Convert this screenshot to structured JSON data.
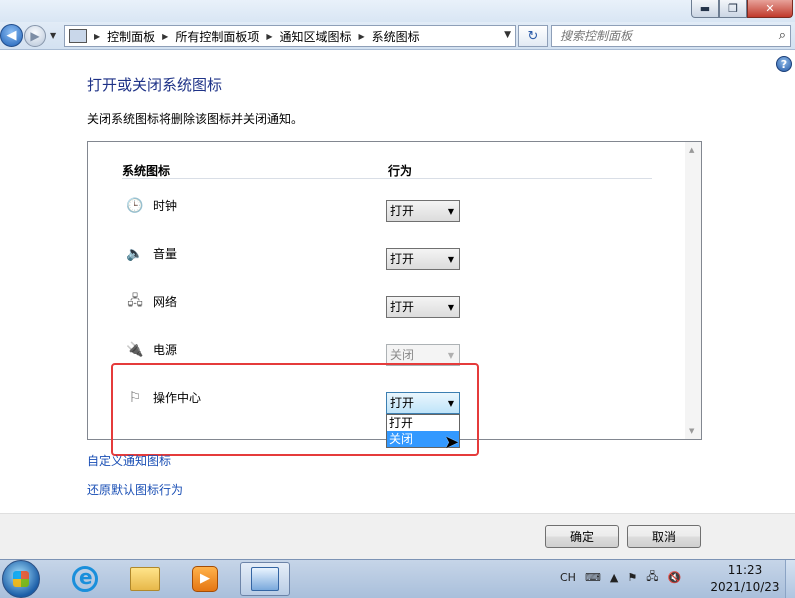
{
  "window": {
    "minimize_glyph": "▬",
    "maximize_glyph": "❐",
    "close_glyph": "✕"
  },
  "nav": {
    "back_glyph": "◀",
    "forward_glyph": "▶",
    "breadcrumb": [
      "控制面板",
      "所有控制面板项",
      "通知区域图标",
      "系统图标"
    ],
    "search_placeholder": "搜索控制面板",
    "refresh_glyph": "↻"
  },
  "help_label": "?",
  "page": {
    "title": "打开或关闭系统图标",
    "description": "关闭系统图标将删除该图标并关闭通知。"
  },
  "table": {
    "col_icon": "系统图标",
    "col_behavior": "行为",
    "rows": [
      {
        "icon": "clock-icon",
        "label": "时钟",
        "value": "打开",
        "disabled": false
      },
      {
        "icon": "volume-icon",
        "label": "音量",
        "value": "打开",
        "disabled": false
      },
      {
        "icon": "network-icon",
        "label": "网络",
        "value": "打开",
        "disabled": false
      },
      {
        "icon": "power-icon",
        "label": "电源",
        "value": "关闭",
        "disabled": true
      },
      {
        "icon": "action-center-flag-icon",
        "label": "操作中心",
        "value": "打开",
        "disabled": false
      }
    ],
    "dropdown_options": [
      "打开",
      "关闭"
    ],
    "dropdown_selected_index": 1
  },
  "links": {
    "customize": "自定义通知图标",
    "restore": "还原默认图标行为"
  },
  "buttons": {
    "ok": "确定",
    "cancel": "取消"
  },
  "taskbar": {
    "input_indicator": "CH",
    "time": "11:23",
    "date": "2021/10/23"
  }
}
